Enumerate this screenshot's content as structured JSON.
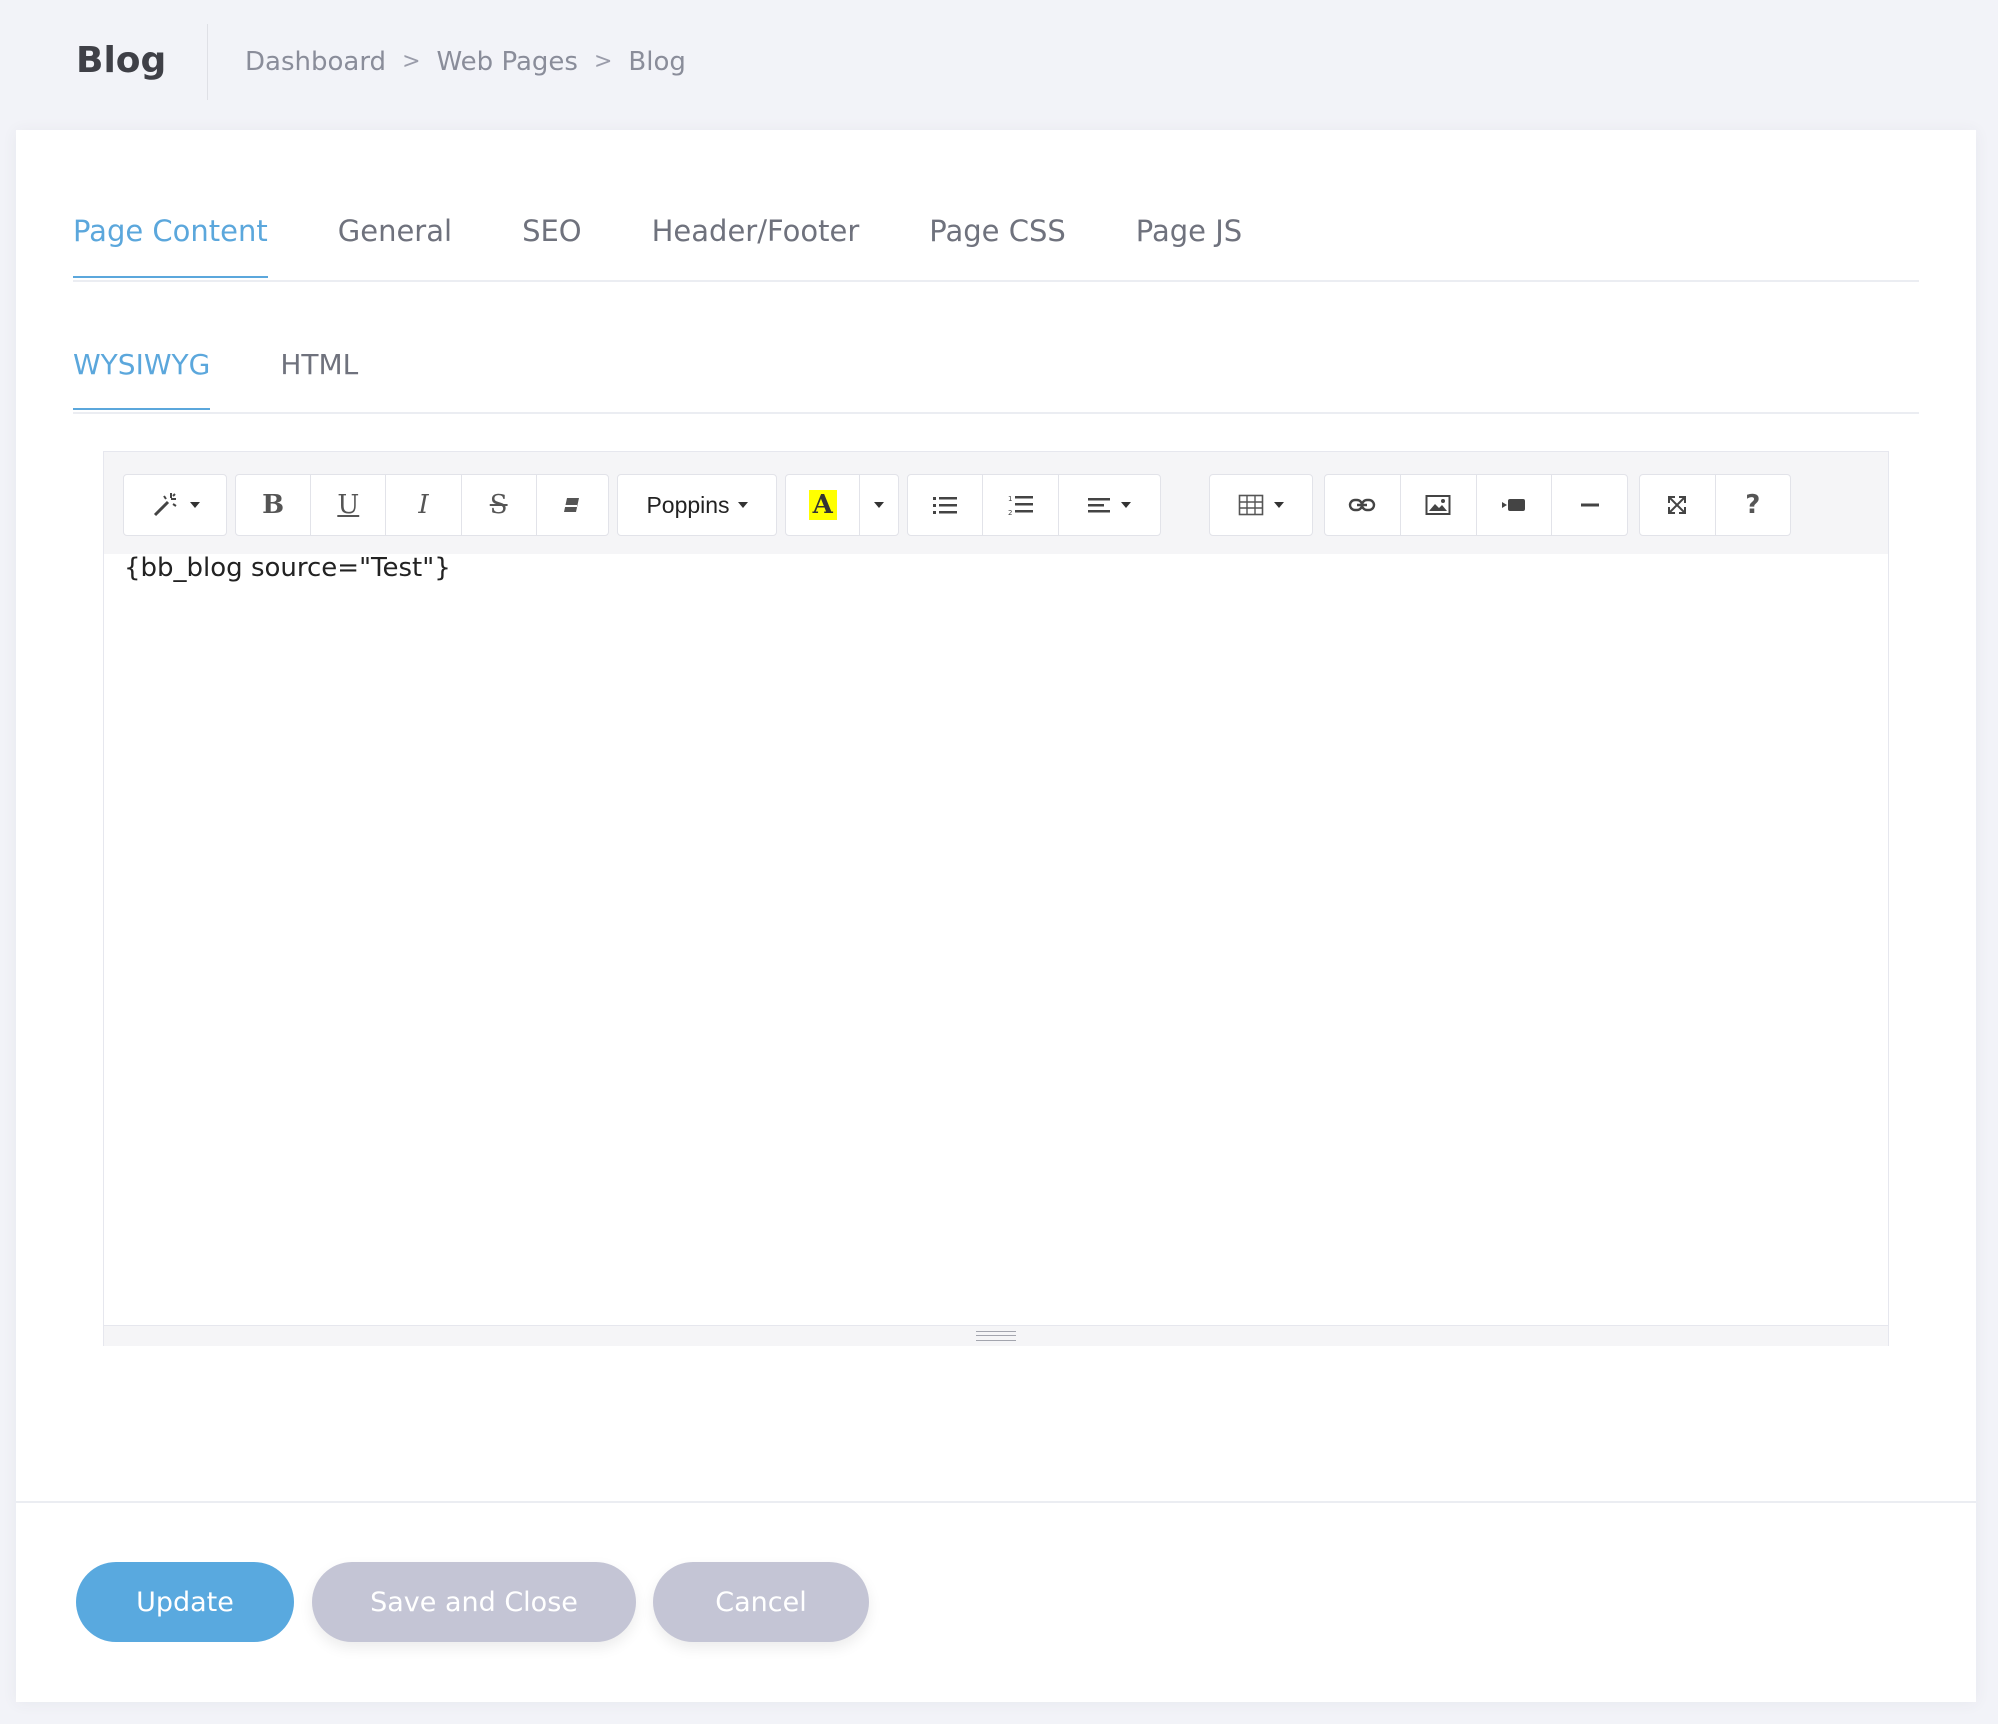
{
  "header": {
    "title": "Blog",
    "breadcrumb": [
      "Dashboard",
      "Web Pages",
      "Blog"
    ],
    "breadcrumb_separator": ">"
  },
  "tabs": [
    "Page Content",
    "General",
    "SEO",
    "Header/Footer",
    "Page CSS",
    "Page JS"
  ],
  "active_tab": "Page Content",
  "subtabs": [
    "WYSIWYG",
    "HTML"
  ],
  "active_subtab": "WYSIWYG",
  "editor": {
    "font_family": "Poppins",
    "highlight_color": "#ffff00",
    "content": "{bb_blog source=\"Test\"}",
    "toolbar_icons": [
      "magic-wand-icon",
      "bold-icon",
      "underline-icon",
      "italic-icon",
      "strikethrough-icon",
      "eraser-icon",
      "font-color-icon",
      "unordered-list-icon",
      "ordered-list-icon",
      "align-left-icon",
      "table-icon",
      "link-icon",
      "picture-icon",
      "video-icon",
      "horizontal-rule-icon",
      "fullscreen-icon",
      "help-icon"
    ]
  },
  "footer": {
    "update_label": "Update",
    "save_close_label": "Save and Close",
    "cancel_label": "Cancel"
  },
  "colors": {
    "accent": "#5ba7dc",
    "primary_button": "#59a9df",
    "secondary_button": "#c4c5d5",
    "background": "#f2f3f8"
  }
}
